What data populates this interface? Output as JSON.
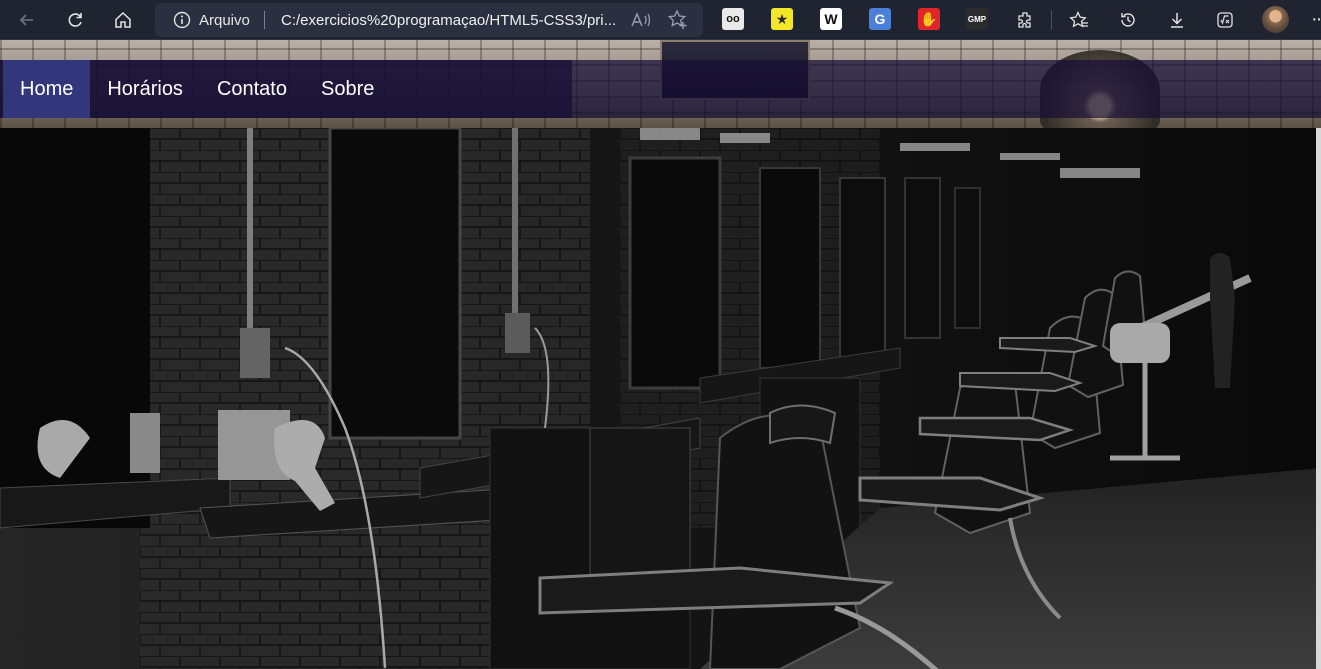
{
  "browser": {
    "address_scheme": "Arquivo",
    "address_url": "C:/exercicios%20programaçao/HTML5-CSS3/pri...",
    "icons": [
      "back-icon",
      "refresh-icon",
      "home-icon",
      "info-icon",
      "read-aloud-icon",
      "add-favorite-icon",
      "extensions-icon",
      "favorites-icon",
      "history-icon",
      "downloads-icon",
      "math-solver-icon",
      "more-icon"
    ],
    "extensions": [
      {
        "name": "tampermonkey-extension-icon",
        "glyph": "oo",
        "bg": "#e9e9e9",
        "fg": "#111111"
      },
      {
        "name": "star-extension-icon",
        "glyph": "★",
        "bg": "#f3e72a",
        "fg": "#2a2a2a"
      },
      {
        "name": "wikipedia-extension-icon",
        "glyph": "W",
        "bg": "#ffffff",
        "fg": "#111111"
      },
      {
        "name": "translate-extension-icon",
        "glyph": "G",
        "bg": "#4a80d8",
        "fg": "#ffffff"
      },
      {
        "name": "adblock-extension-icon",
        "glyph": "✋",
        "bg": "#e0262a",
        "fg": "#ffffff"
      },
      {
        "name": "gmp-extension-icon",
        "glyph": "GMP",
        "bg": "#2b2b2b",
        "fg": "#ffffff"
      }
    ]
  },
  "nav": {
    "items": [
      {
        "label": "Home",
        "active": true
      },
      {
        "label": "Horários",
        "active": false
      },
      {
        "label": "Contato",
        "active": false
      },
      {
        "label": "Sobre",
        "active": false
      }
    ]
  },
  "hero": {
    "image": "barbershop-interior-photo"
  },
  "colors": {
    "nav_bg": "#160e34",
    "nav_active": "#31377a",
    "chrome_bg": "#1f2430"
  }
}
